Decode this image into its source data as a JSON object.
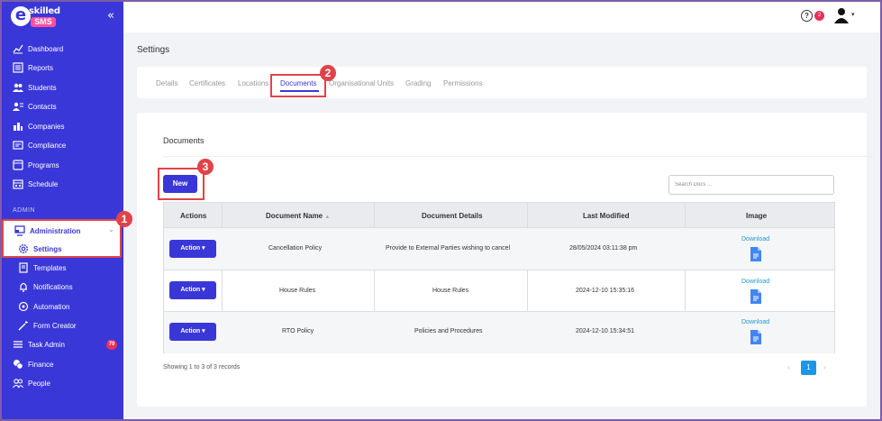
{
  "brand": {
    "logo_letter": "e",
    "logo_word": "skilled",
    "logo_badge": "SMS",
    "collapse_icon": "double-chevron-left-icon"
  },
  "sidebar": {
    "items": [
      {
        "label": "Dashboard",
        "icon": "chart-line-icon"
      },
      {
        "label": "Reports",
        "icon": "report-icon"
      },
      {
        "label": "Students",
        "icon": "users-icon"
      },
      {
        "label": "Contacts",
        "icon": "contacts-icon"
      },
      {
        "label": "Companies",
        "icon": "building-icon"
      },
      {
        "label": "Compliance",
        "icon": "compliance-icon"
      },
      {
        "label": "Programs",
        "icon": "programs-icon"
      },
      {
        "label": "Schedule",
        "icon": "calendar-icon"
      }
    ],
    "section_label": "ADMIN",
    "admin": {
      "label": "Administration",
      "icon": "monitor-icon",
      "expanded_icon": "chevron-down-icon"
    },
    "settings": {
      "label": "Settings",
      "icon": "gear-icon"
    },
    "sub_items": [
      {
        "label": "Templates",
        "icon": "template-icon"
      },
      {
        "label": "Notifications",
        "icon": "bell-icon"
      },
      {
        "label": "Automation",
        "icon": "automation-icon"
      },
      {
        "label": "Form Creator",
        "icon": "wand-icon"
      }
    ],
    "lower_items": [
      {
        "label": "Task Admin",
        "icon": "list-icon",
        "badge": "70"
      },
      {
        "label": "Finance",
        "icon": "coins-icon"
      },
      {
        "label": "People",
        "icon": "people-icon"
      }
    ]
  },
  "topbar": {
    "help_badge": "2",
    "help_label": "?"
  },
  "page": {
    "title": "Settings"
  },
  "tabs": [
    "Details",
    "Certificates",
    "Locations",
    "Documents",
    "Organisational Units",
    "Grading",
    "Permissions"
  ],
  "active_tab": "Documents",
  "documents": {
    "title": "Documents",
    "new_button": "New",
    "search_placeholder": "Search Docs ...",
    "columns": [
      "Actions",
      "Document Name",
      "Document Details",
      "Last Modified",
      "Image"
    ],
    "sort_indicator": "▲",
    "rows": [
      {
        "action": "Action",
        "name": "Cancellation Policy",
        "details": "Provide to External Parties wishing to cancel",
        "modified": "28/05/2024 03:11:38 pm",
        "image_link": "Download"
      },
      {
        "action": "Action",
        "name": "House Rules",
        "details": "House Rules",
        "modified": "2024-12-10 15:35:16",
        "image_link": "Download"
      },
      {
        "action": "Action",
        "name": "RTO Policy",
        "details": "Policies and Procedures",
        "modified": "2024-12-10 15:34:51",
        "image_link": "Download"
      }
    ],
    "showing": "Showing 1 to 3 of 3 records",
    "pager": {
      "prev": "‹",
      "current": "1",
      "next": "›"
    }
  },
  "callouts": [
    "1",
    "2",
    "3"
  ],
  "colors": {
    "sidebar": "#3a37d8",
    "accent": "#3a37d8",
    "callout": "#e0434a",
    "badge": "#e8305a",
    "link": "#2196d3"
  }
}
